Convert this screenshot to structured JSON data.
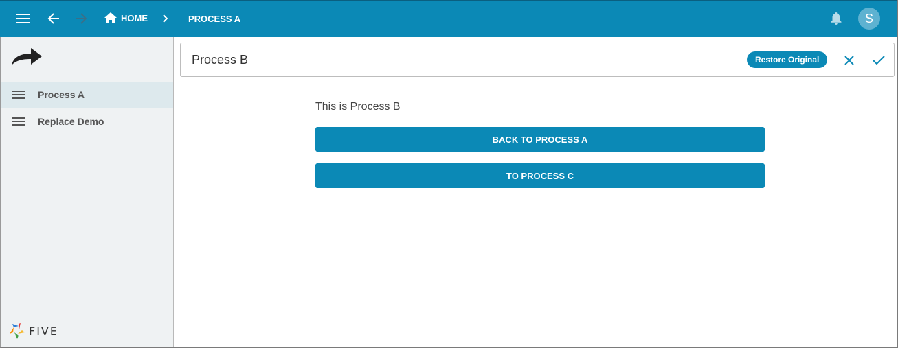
{
  "colors": {
    "primary": "#0b89b6",
    "avatar_bg": "#5eb2d1",
    "sidebar_bg": "#eff2f3",
    "sidebar_active": "#dde9ed"
  },
  "topbar": {
    "icons": {
      "menu": "menu-icon",
      "back": "arrow-left-icon",
      "forward": "arrow-right-icon",
      "home": "home-icon",
      "separator": "chevron-right-icon",
      "notifications": "bell-icon"
    },
    "breadcrumb": {
      "home_label": "HOME",
      "current_label": "PROCESS A"
    },
    "avatar_initial": "S"
  },
  "sidebar": {
    "logo_icon": "curved-arrow-icon",
    "items": [
      {
        "label": "Process A",
        "active": true
      },
      {
        "label": "Replace Demo",
        "active": false
      }
    ],
    "brand": "FIVE"
  },
  "form": {
    "title": "Process B",
    "restore_label": "Restore Original",
    "close_icon": "close-icon",
    "save_icon": "check-icon"
  },
  "content": {
    "text": "This is Process B",
    "buttons": [
      {
        "label": "BACK TO PROCESS A"
      },
      {
        "label": "TO PROCESS C"
      }
    ]
  }
}
